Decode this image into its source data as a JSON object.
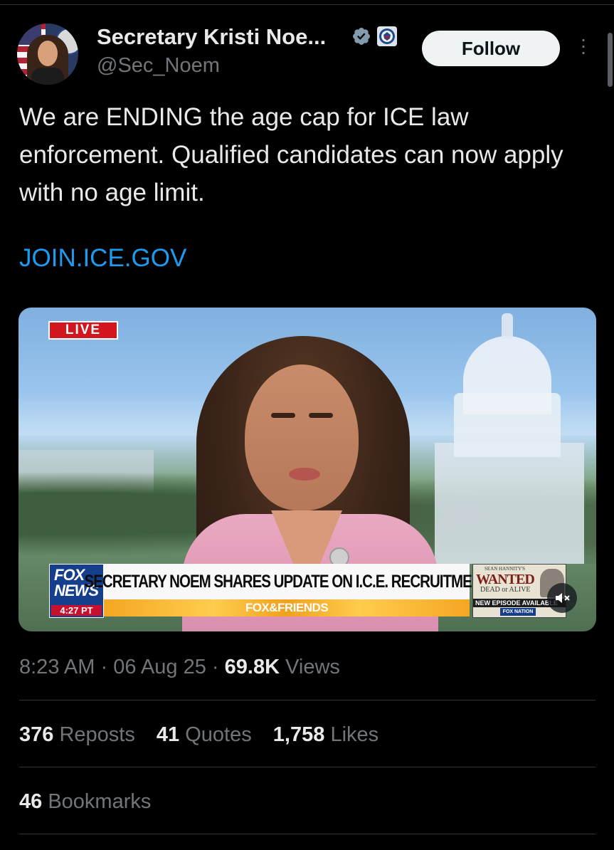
{
  "author": {
    "name": "Secretary Kristi Noe...",
    "handle": "@Sec_Noem",
    "verified_icon": "verified-badge-icon",
    "affiliation_icon": "dhs-seal-icon"
  },
  "follow_label": "Follow",
  "more_icon": "more-options-icon",
  "tweet": {
    "text": "We are ENDING the age cap for ICE law enforcement. Qualified candidates can now apply with no age limit.",
    "link": "JOIN.ICE.GOV"
  },
  "video": {
    "live_label": "LIVE",
    "fox_word": "FOX",
    "news_word": "NEWS",
    "clock": "4:27 PT",
    "chyron": "SECRETARY NOEM SHARES UPDATE ON I.C.E. RECRUITMENT",
    "show": "FOX&FRIENDS",
    "promo_top": "SEAN HANNITY'S",
    "promo_title": "WANTED",
    "promo_subtitle": "DEAD or ALIVE",
    "promo_new": "NEW EPISODE AVAILABLE",
    "promo_network": "FOX NATION",
    "mute_icon": "speaker-muted-icon"
  },
  "meta": {
    "time": "8:23 AM",
    "separator": "·",
    "date": "06 Aug 25",
    "views_count": "69.8K",
    "views_label": "Views"
  },
  "stats": {
    "reposts_count": "376",
    "reposts_label": "Reposts",
    "quotes_count": "41",
    "quotes_label": "Quotes",
    "likes_count": "1,758",
    "likes_label": "Likes",
    "bookmarks_count": "46",
    "bookmarks_label": "Bookmarks"
  },
  "colors": {
    "background": "#000000",
    "text": "#e7e9ea",
    "muted": "#71767b",
    "link": "#1d9bf0",
    "verified": "#829aab"
  }
}
